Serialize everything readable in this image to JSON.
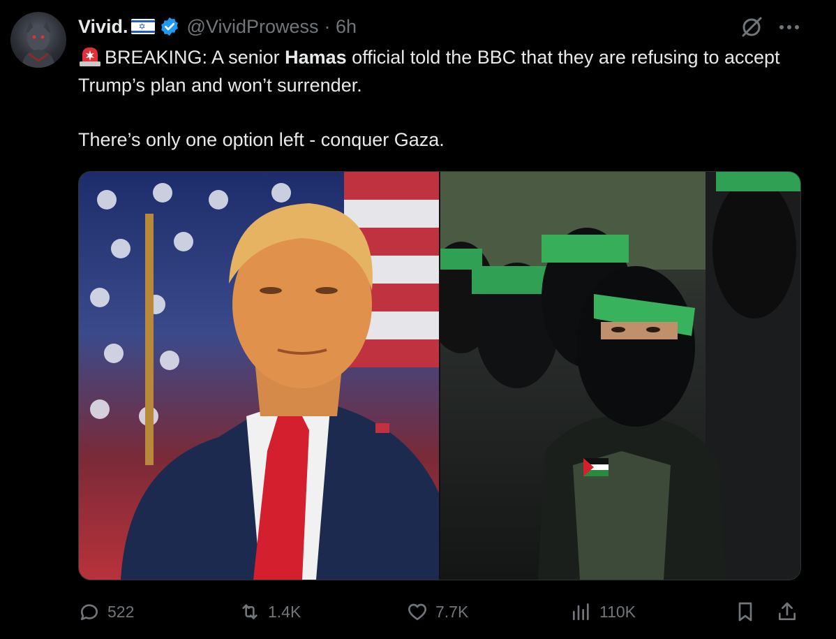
{
  "author": {
    "display_name": "Vivid.",
    "handle": "@VividProwess",
    "time": "· 6h",
    "flag_icon": "israel-flag-icon",
    "verified_icon": "verified-badge-icon"
  },
  "tweet": {
    "line1_prefix": "BREAKING: A senior ",
    "line1_bold": "Hamas",
    "line1_suffix": " official told the BBC that they are refusing to accept Trump’s plan and won’t surrender.",
    "line2": "There’s only one option left - conquer Gaza.",
    "emoji_icon": "police-siren-icon"
  },
  "media": {
    "left_photo": "trump-photo",
    "right_photo": "hamas-fighters-photo"
  },
  "actions": {
    "replies": "522",
    "reposts": "1.4K",
    "likes": "7.7K",
    "views": "110K"
  },
  "colors": {
    "background": "#000000",
    "text": "#e7e9ea",
    "muted": "#71767b",
    "verified": "#1d9bf0"
  }
}
